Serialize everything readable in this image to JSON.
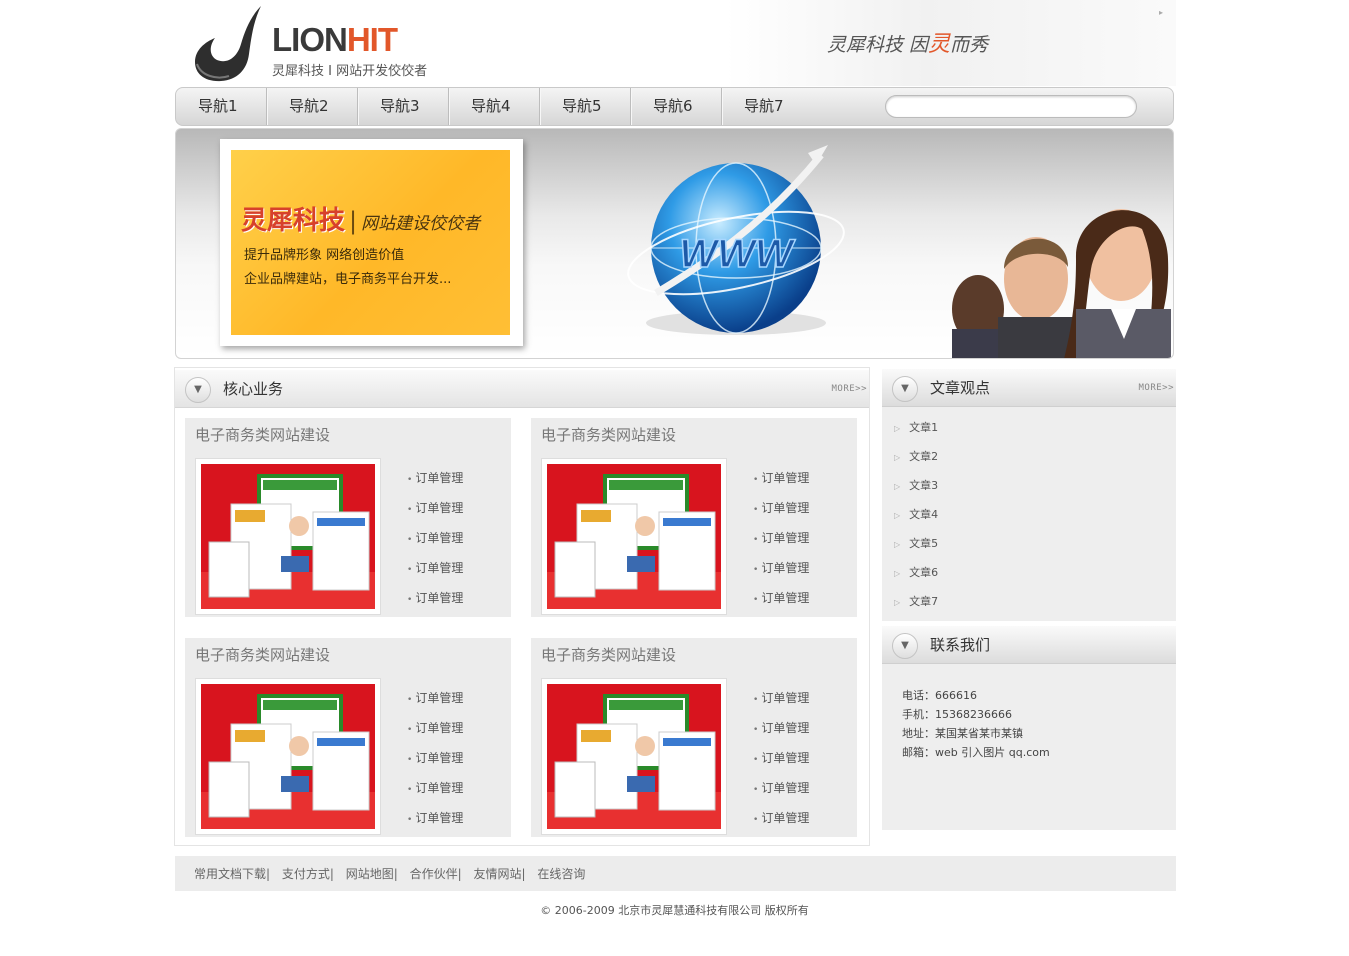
{
  "header": {
    "logo_lion": "LION",
    "logo_hit": "HIT",
    "logo_sub": "灵犀科技 I 网站开发佼佼者",
    "slogan_pre": "灵犀科技 因",
    "slogan_accent": "灵",
    "slogan_post": "而秀"
  },
  "nav": {
    "items": [
      "导航1",
      "导航2",
      "导航3",
      "导航4",
      "导航5",
      "导航6",
      "导航7"
    ],
    "search_value": ""
  },
  "banner": {
    "title": "灵犀科技",
    "sep": "|",
    "tagline": "网站建设佼佼者",
    "line1": "提升品牌形象 网络创造价值",
    "line2": "企业品牌建站，电子商务平台开发...",
    "globe_text": "WWW"
  },
  "core": {
    "title": "核心业务",
    "more": "MORE>>",
    "cards": [
      {
        "title": "电子商务类网站建设",
        "items": [
          "订单管理",
          "订单管理",
          "订单管理",
          "订单管理",
          "订单管理"
        ]
      },
      {
        "title": "电子商务类网站建设",
        "items": [
          "订单管理",
          "订单管理",
          "订单管理",
          "订单管理",
          "订单管理"
        ]
      },
      {
        "title": "电子商务类网站建设",
        "items": [
          "订单管理",
          "订单管理",
          "订单管理",
          "订单管理",
          "订单管理"
        ]
      },
      {
        "title": "电子商务类网站建设",
        "items": [
          "订单管理",
          "订单管理",
          "订单管理",
          "订单管理",
          "订单管理"
        ]
      }
    ]
  },
  "articles": {
    "title": "文章观点",
    "more": "MORE>>",
    "items": [
      "文章1",
      "文章2",
      "文章3",
      "文章4",
      "文章5",
      "文章6",
      "文章7"
    ]
  },
  "contact": {
    "title": "联系我们",
    "phone": "电话：666616",
    "mobile": "手机：15368236666",
    "address": "地址：某国某省某市某镇",
    "email": "邮箱：web 引入图片 qq.com"
  },
  "footer": {
    "links": [
      "常用文档下载|",
      "支付方式|",
      "网站地图|",
      "合作伙伴|",
      "友情网站|",
      "在线咨询"
    ],
    "copyright": "© 2006-2009 北京市灵犀慧通科技有限公司 版权所有"
  },
  "colors": {
    "accent": "#e2572a",
    "banner_card": "#ffb828",
    "panel_bg": "#ececec"
  }
}
